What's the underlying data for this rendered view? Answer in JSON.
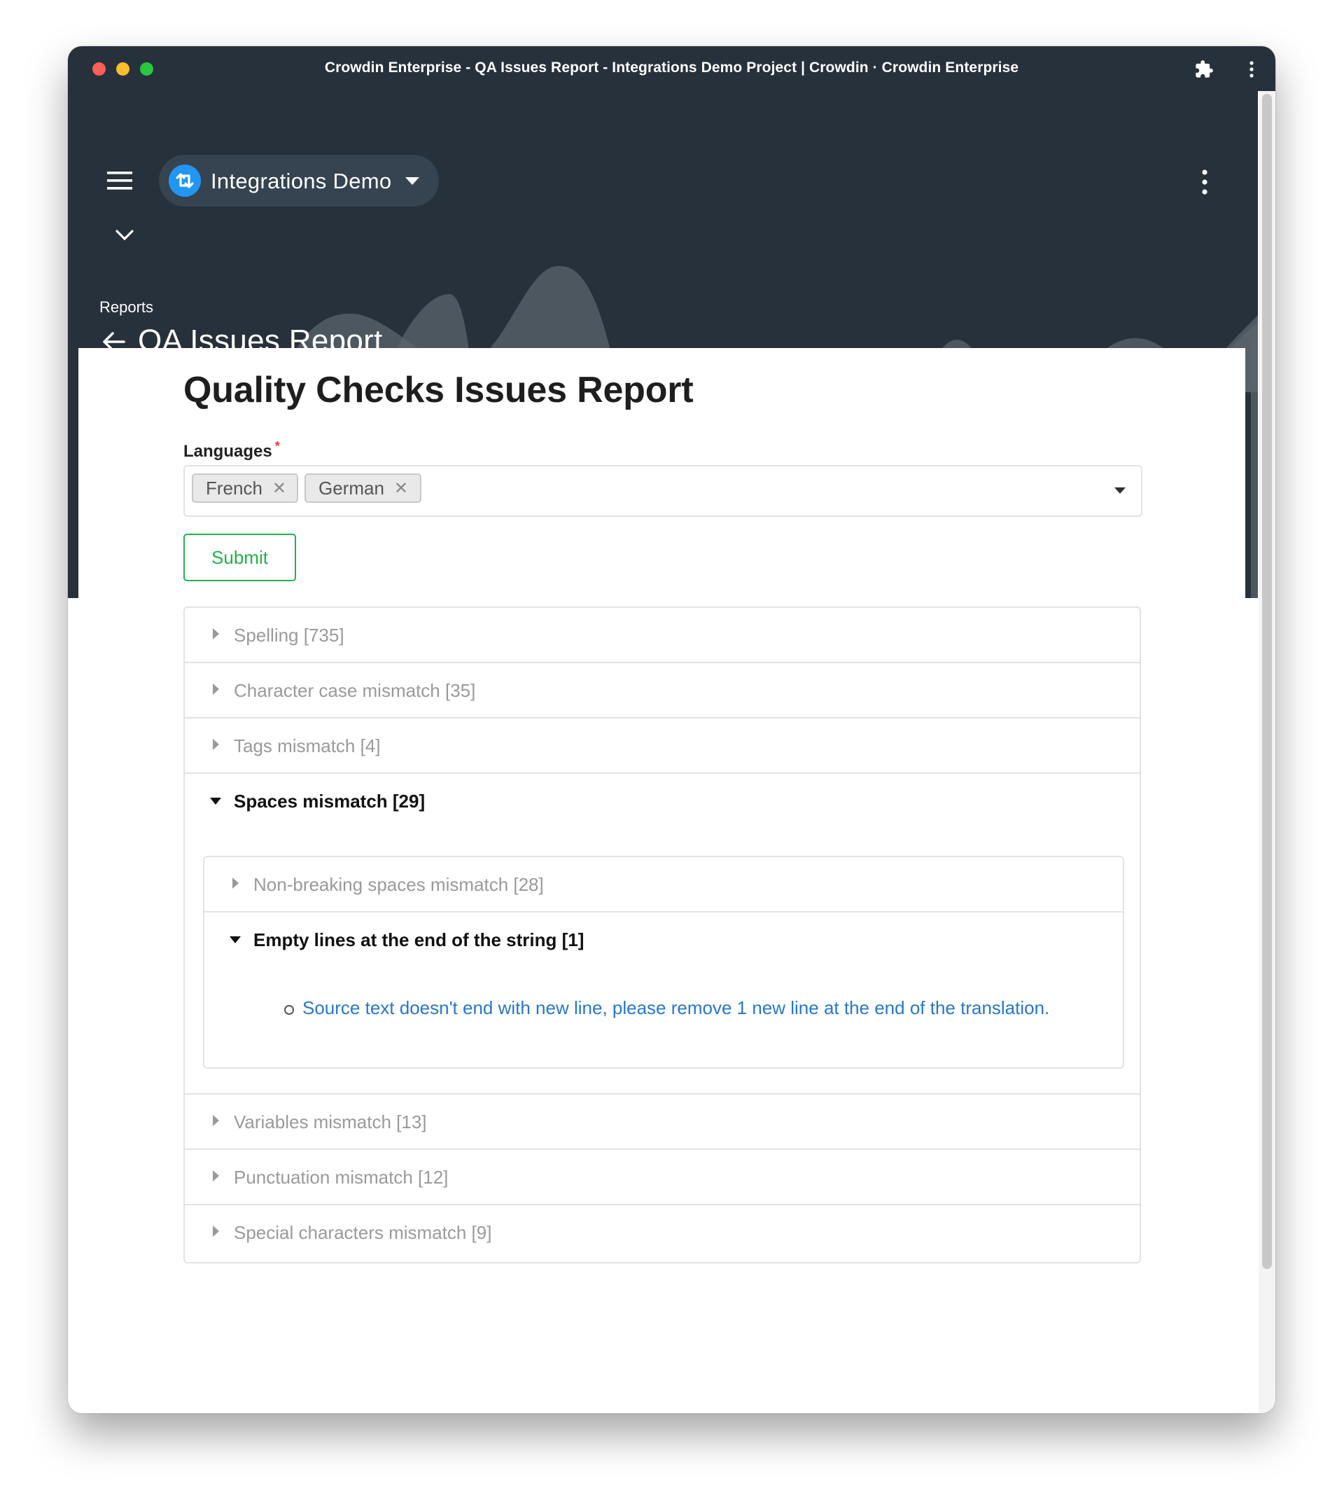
{
  "window": {
    "title": "Crowdin Enterprise - QA Issues Report - Integrations Demo Project | Crowdin · Crowdin Enterprise"
  },
  "header": {
    "project_name": "Integrations Demo",
    "breadcrumb": "Reports",
    "page_title": "QA Issues Report",
    "icons": [
      "menu-icon",
      "project-logo-icon",
      "caret-down-icon",
      "more-vert-icon",
      "chevron-down-icon",
      "arrow-back-icon",
      "puzzle-icon"
    ]
  },
  "report": {
    "heading": "Quality Checks Issues Report",
    "languages_label": "Languages",
    "required_mark": "*",
    "selected_languages": [
      "French",
      "German"
    ],
    "chip_remove_glyph": "✕",
    "submit_label": "Submit"
  },
  "issues": {
    "categories": [
      {
        "label": "Spelling [735]",
        "expanded": false
      },
      {
        "label": "Character case mismatch [35]",
        "expanded": false
      },
      {
        "label": "Tags mismatch [4]",
        "expanded": false
      },
      {
        "label": "Spaces mismatch [29]",
        "expanded": true
      },
      {
        "label": "Variables mismatch [13]",
        "expanded": false
      },
      {
        "label": "Punctuation mismatch [12]",
        "expanded": false
      },
      {
        "label": "Special characters mismatch [9]",
        "expanded": false
      }
    ],
    "spaces_subcategories": [
      {
        "label": "Non-breaking spaces mismatch [28]",
        "expanded": false
      },
      {
        "label": "Empty lines at the end of the string [1]",
        "expanded": true
      }
    ],
    "empty_lines_issues": [
      "Source text doesn't end with new line, please remove 1 new line at the end of the translation."
    ]
  },
  "colors": {
    "header_bg": "#27313b",
    "accent_green": "#22b14c",
    "link_blue": "#2877c8",
    "project_blue": "#2196f3",
    "required_red": "#e53935"
  }
}
